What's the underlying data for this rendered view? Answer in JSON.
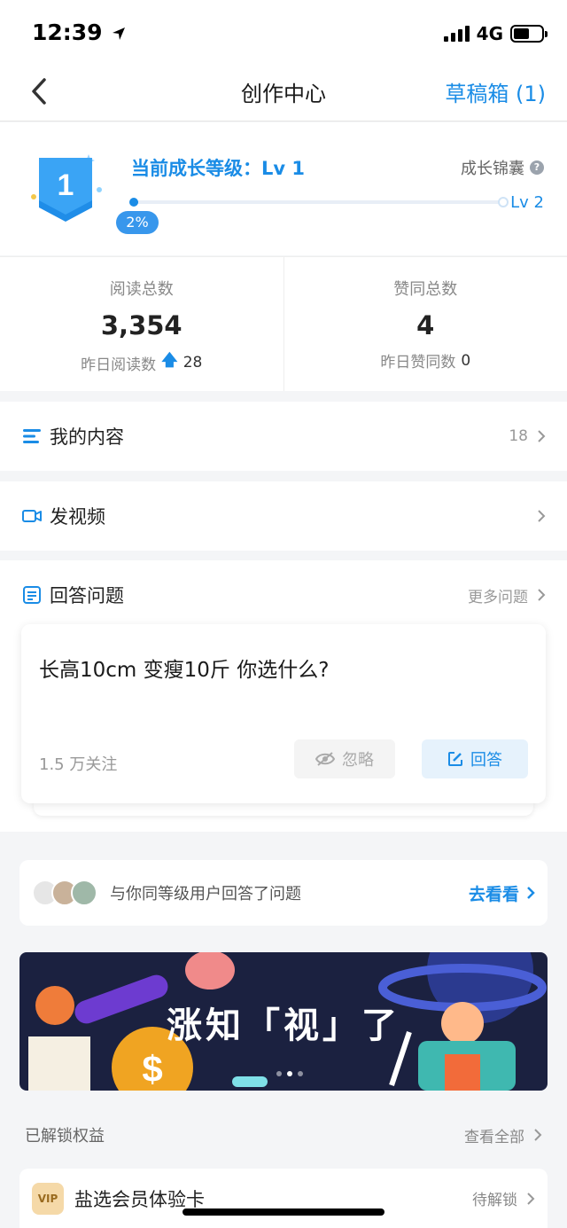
{
  "status": {
    "time": "12:39",
    "network": "4G"
  },
  "nav": {
    "title": "创作中心",
    "drafts": "草稿箱 (1)"
  },
  "level": {
    "badge_number": "1",
    "title": "当前成长等级：Lv 1",
    "tips": "成长锦囊",
    "next": "Lv 2",
    "progress_text": "2%",
    "progress": 0.02
  },
  "stats": {
    "reads": {
      "label": "阅读总数",
      "value": "3,354",
      "sub_label": "昨日阅读数",
      "sub_value": "28"
    },
    "likes": {
      "label": "赞同总数",
      "value": "4",
      "sub_label": "昨日赞同数",
      "sub_value": "0"
    }
  },
  "menu": {
    "my_content": {
      "label": "我的内容",
      "count": "18"
    },
    "video": {
      "label": "发视频"
    }
  },
  "answer": {
    "title": "回答问题",
    "more": "更多问题",
    "question": "长高10cm 变瘦10斤 你选什么?",
    "followers": "1.5 万关注",
    "ignore": "忽略",
    "reply": "回答"
  },
  "peers": {
    "text": "与你同等级用户回答了问题",
    "go": "去看看"
  },
  "banner": {
    "text": "涨知「视」了"
  },
  "rights": {
    "title": "已解锁权益",
    "view_all": "查看全部",
    "item_badge": "VIP",
    "item_label": "盐选会员体验卡",
    "item_status": "待解锁"
  },
  "colors": {
    "accent": "#1a8ce6",
    "banner_bg": "#1b2140"
  }
}
